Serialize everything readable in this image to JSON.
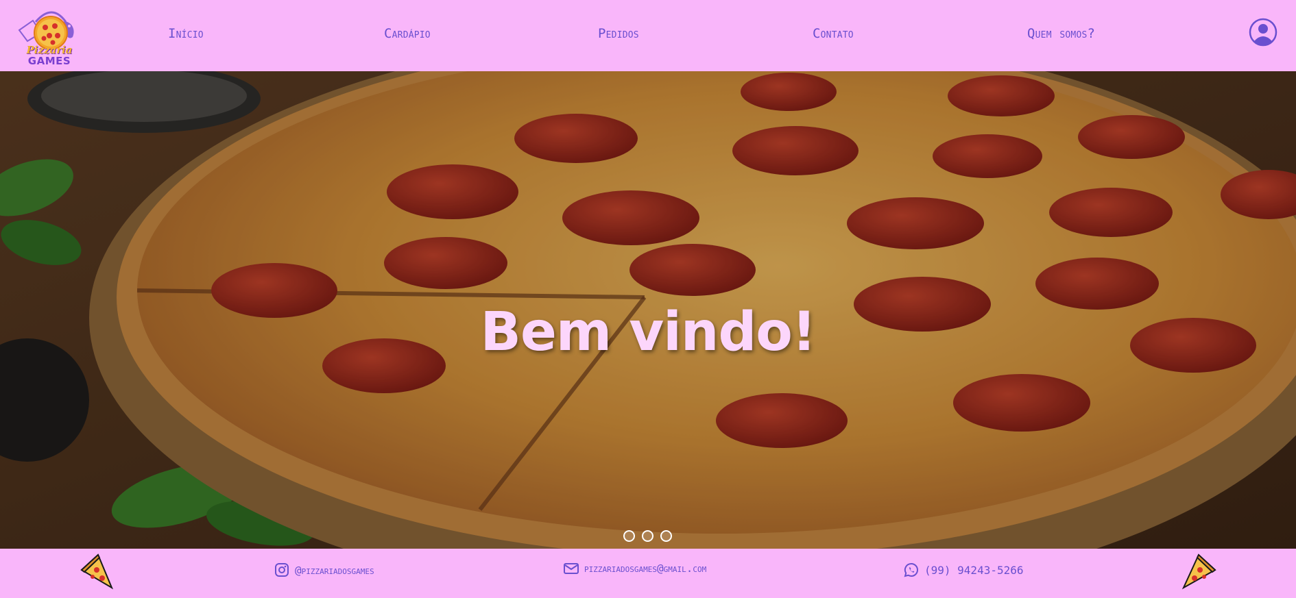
{
  "brand": {
    "line1": "Pizzaria",
    "line2": "GAMES"
  },
  "nav": {
    "items": [
      {
        "label": "Início"
      },
      {
        "label": "Cardápio"
      },
      {
        "label": "Pedidos"
      },
      {
        "label": "Contato"
      },
      {
        "label": "Quem somos?"
      }
    ]
  },
  "hero": {
    "title": "Bem vindo!",
    "slides": 3,
    "active_slide": 1
  },
  "footer": {
    "instagram": "@pizzariadosgames",
    "email": "pizzariadosgames@gmail.com",
    "phone": "(99) 94243-5266"
  },
  "colors": {
    "background": "#f9b6fa",
    "nav_text": "#6a4fcf",
    "hero_title": "#fcd6fb"
  },
  "icons": [
    "pizza-logo-icon",
    "user-profile-icon",
    "instagram-icon",
    "mail-icon",
    "whatsapp-icon",
    "pizza-slice-icon"
  ]
}
